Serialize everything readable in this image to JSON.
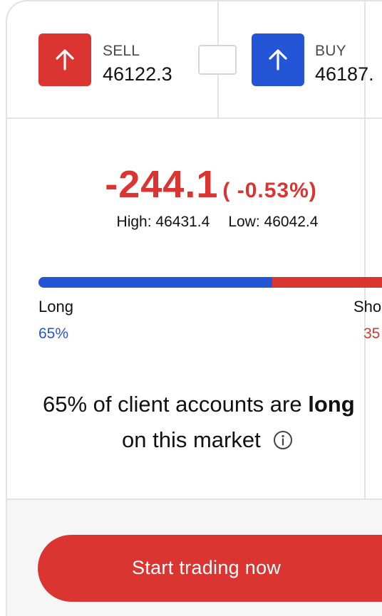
{
  "trade": {
    "sell": {
      "label": "SELL",
      "price": "46122.3",
      "icon": "arrow-up-icon",
      "color": "#db3532"
    },
    "buy": {
      "label": "BUY",
      "price": "46187.",
      "icon": "arrow-up-icon",
      "color": "#2455d6"
    },
    "quantity_value": ""
  },
  "change": {
    "value": "-244.1",
    "percent": "( -0.53%)",
    "high_label": "High: 46431.4",
    "low_label": "Low: 46042.4",
    "color": "#db3532"
  },
  "sentiment": {
    "long_label": "Long",
    "long_percent": "65%",
    "long_fraction": 0.65,
    "short_label": "Sho",
    "short_percent": "35",
    "long_color": "#2455d6",
    "short_color": "#db3532"
  },
  "statement": {
    "lead": "65% of client accounts are ",
    "emphasis": "long",
    "line2": "on this market",
    "icon": "info-icon"
  },
  "cta": {
    "label": "Start trading now"
  }
}
